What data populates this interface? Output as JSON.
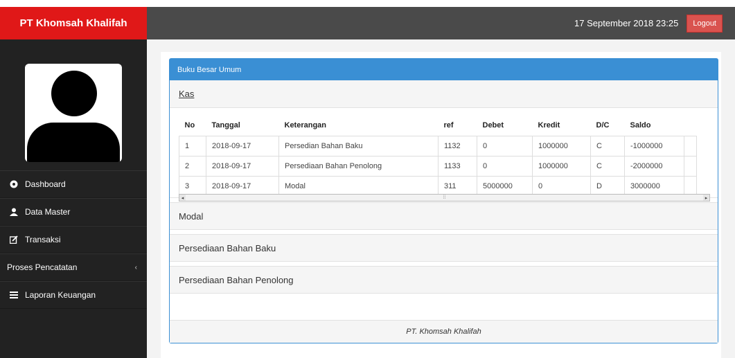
{
  "app": {
    "brand": "PT Khomsah Khalifah"
  },
  "header": {
    "datetime": "17 September 2018 23:25",
    "logout_label": "Logout"
  },
  "sidebar": {
    "items": [
      {
        "label": "Dashboard",
        "icon": "dashboard-icon"
      },
      {
        "label": "Data Master",
        "icon": "user-icon"
      },
      {
        "label": "Transaksi",
        "icon": "edit-icon"
      },
      {
        "label": "Proses Pencatatan",
        "icon": "chevron-left-icon"
      },
      {
        "label": "Laporan Keuangan",
        "icon": "list-icon"
      }
    ]
  },
  "panel": {
    "title": "Buku Besar Umum",
    "sections": [
      "Kas",
      "Modal",
      "Persediaan Bahan Baku",
      "Persediaan Bahan Penolong"
    ],
    "footer": "PT. Khomsah Khalifah"
  },
  "table": {
    "headers": [
      "No",
      "Tanggal",
      "Keterangan",
      "ref",
      "Debet",
      "Kredit",
      "D/C",
      "Saldo"
    ],
    "rows": [
      [
        "1",
        "2018-09-17",
        "Persedian Bahan Baku",
        "1132",
        "0",
        "1000000",
        "C",
        "-1000000"
      ],
      [
        "2",
        "2018-09-17",
        "Persediaan Bahan Penolong",
        "1133",
        "0",
        "1000000",
        "C",
        "-2000000"
      ],
      [
        "3",
        "2018-09-17",
        "Modal",
        "311",
        "5000000",
        "0",
        "D",
        "3000000"
      ]
    ]
  },
  "colors": {
    "brand": "#e01818",
    "sidebar": "#222222",
    "topbar": "#4a4a4a",
    "panel_accent": "#3a8fd4",
    "logout": "#d9534f"
  }
}
